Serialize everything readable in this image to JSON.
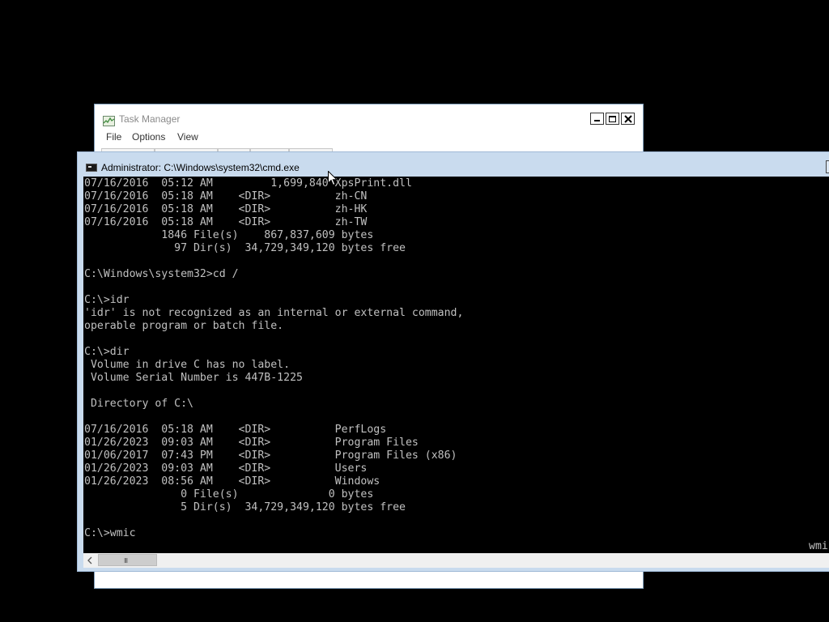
{
  "task_manager": {
    "title": "Task Manager",
    "menu": {
      "file": "File",
      "options": "Options",
      "view": "View"
    },
    "icon": "task-manager-icon"
  },
  "cmd_window": {
    "title": "Administrator: C:\\Windows\\system32\\cmd.exe",
    "icon": "console-icon",
    "console_text": "07/16/2016  05:12 AM         1,699,840 XpsPrint.dll\n07/16/2016  05:18 AM    <DIR>          zh-CN\n07/16/2016  05:18 AM    <DIR>          zh-HK\n07/16/2016  05:18 AM    <DIR>          zh-TW\n            1846 File(s)    867,837,609 bytes\n              97 Dir(s)  34,729,349,120 bytes free\n\nC:\\Windows\\system32>cd /\n\nC:\\>idr\n'idr' is not recognized as an internal or external command,\noperable program or batch file.\n\nC:\\>dir\n Volume in drive C has no label.\n Volume Serial Number is 447B-1225\n\n Directory of C:\\\n\n07/16/2016  05:18 AM    <DIR>          PerfLogs\n01/26/2023  09:03 AM    <DIR>          Program Files\n01/06/2017  07:43 PM    <DIR>          Program Files (x86)\n01/26/2023  09:03 AM    <DIR>          Users\n01/26/2023  08:56 AM    <DIR>          Windows\n               0 File(s)              0 bytes\n               5 Dir(s)  34,729,349,120 bytes free\n\nC:\\>wmic",
    "right_edge_text": "wmi",
    "scrollbar_grip": "III"
  },
  "colors": {
    "console_bg": "#000000",
    "console_fg": "#c0c0c0",
    "cmd_frame": "#c9dbee",
    "desktop": "#000000"
  }
}
